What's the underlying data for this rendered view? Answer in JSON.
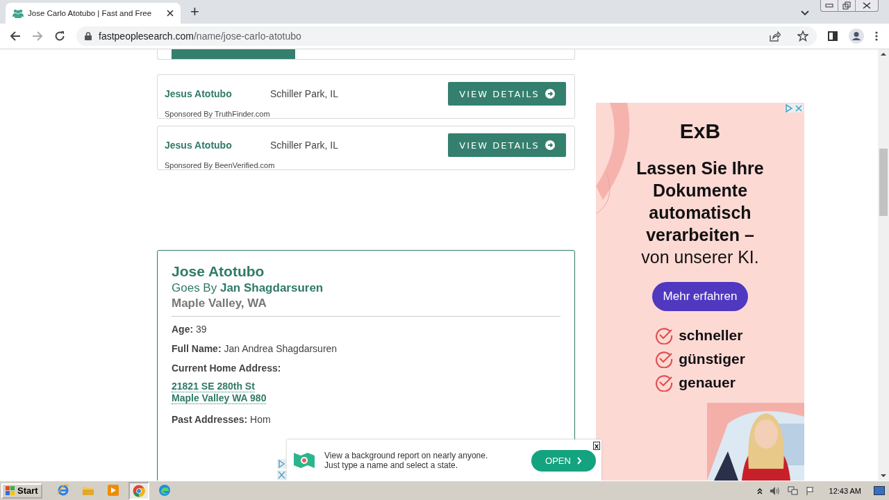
{
  "browser": {
    "tab_title": "Jose Carlo Atotubo | Fast and Free",
    "new_tab": "+",
    "url_domain": "fastpeoplesearch.com",
    "url_path": "/name/jose-carlo-atotubo"
  },
  "results": [
    {
      "name": "Jesus Atotubo",
      "location": "Schiller Park, IL",
      "sponsor": "Sponsored By TruthFinder.com",
      "button": "VIEW DETAILS"
    },
    {
      "name": "Jesus Atotubo",
      "location": "Schiller Park, IL",
      "sponsor": "Sponsored By BeenVerified.com",
      "button": "VIEW DETAILS"
    }
  ],
  "profile": {
    "name": "Jose Atotubo",
    "goes_by": "Goes By **Jan Shagdarsuren**",
    "location": "Maple Valley, WA",
    "fields": [
      {
        "label": "Age:",
        "value": "39"
      },
      {
        "label": "Full Name:",
        "value": "Jan Andrea Shagdarsuren"
      }
    ],
    "address_label": "Current Home Address:",
    "address_lines": [
      "21821 SE 280th St",
      "Maple Valley WA 980"
    ],
    "past_label": "Past Addresses:",
    "past_value": "Hom"
  },
  "side_ad": {
    "logo": "ExB",
    "headline": [
      "Lassen Sie Ihre",
      "Dokumente",
      "automatisch",
      "verarbeiten –"
    ],
    "subline": "von unserer KI.",
    "button": "Mehr erfahren",
    "benefits": [
      "schneller",
      "günstiger",
      "genauer"
    ]
  },
  "bottom_ad": {
    "lines": [
      "View a background report on nearly anyone.",
      "Just type a name and select a state."
    ],
    "button": "OPEN",
    "close": "x"
  },
  "taskbar": {
    "start": "Start",
    "time": "12:43 AM",
    "apps": [
      {
        "kind": "ie",
        "selected": false
      },
      {
        "kind": "folder",
        "selected": false
      },
      {
        "kind": "media",
        "selected": false
      },
      {
        "kind": "chrome",
        "selected": true
      },
      {
        "kind": "edge",
        "selected": false
      }
    ]
  }
}
